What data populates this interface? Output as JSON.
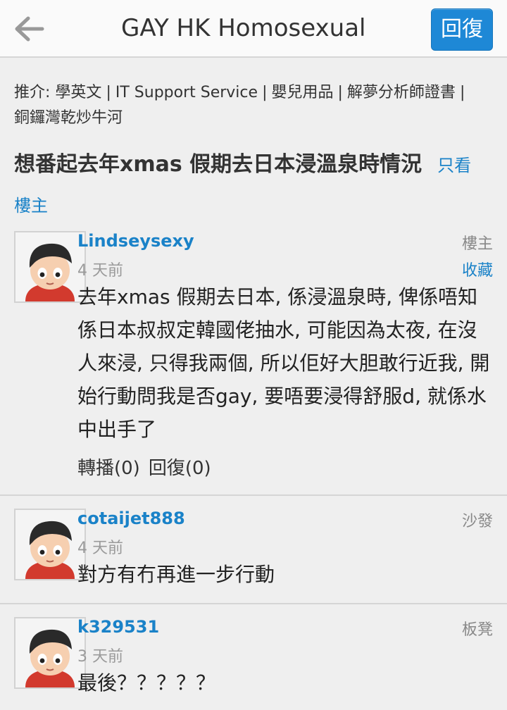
{
  "header": {
    "title": "GAY HK Homosexual",
    "reply_label": "回復"
  },
  "promo": {
    "prefix": "推介:",
    "links": [
      "學英文",
      "IT Support Service",
      "嬰兒用品",
      "解夢分析師證書",
      "銅鑼灣乾炒牛河"
    ]
  },
  "thread": {
    "title": "想番起去年xmas 假期去日本浸溫泉時情況",
    "only_op_part1": "只看",
    "only_op_part2": "樓主"
  },
  "posts": [
    {
      "username": "Lindseysexy",
      "time": "4 天前",
      "rank": "樓主",
      "favorite": "收藏",
      "text": "去年xmas 假期去日本, 係浸溫泉時, 俾係唔知係日本叔叔定韓國佬抽水, 可能因為太夜, 在沒人來浸, 只得我兩個, 所以佢好大胆敢行近我, 開始行動問我是否gay, 要唔要浸得舒服d, 就係水中出手了",
      "share": "轉播(0)",
      "reply": "回復(0)"
    },
    {
      "username": "cotaijet888",
      "time": "4 天前",
      "rank": "沙發",
      "text": "對方有冇再進一步行動"
    },
    {
      "username": "k329531",
      "time": "3 天前",
      "rank": "板凳",
      "text": "最後？？？？？"
    }
  ],
  "colors": {
    "accent": "#1a82c8",
    "reply_button": "#1e88d6",
    "background": "#efefef"
  }
}
